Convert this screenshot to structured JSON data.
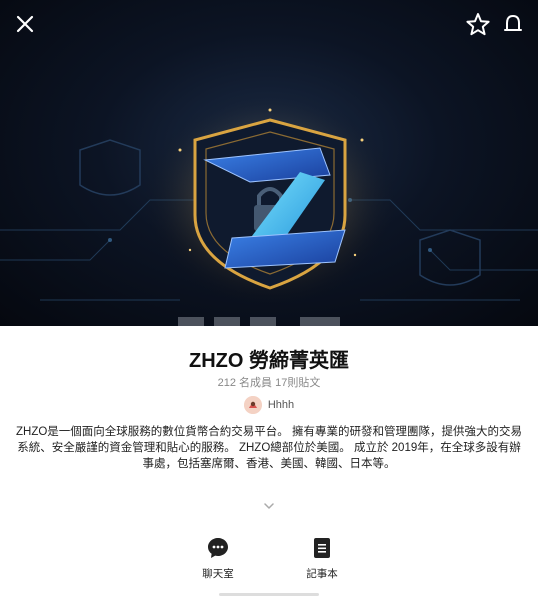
{
  "hero": {
    "close_icon": "close-icon",
    "star_icon": "star-icon",
    "bell_icon": "bell-icon",
    "logo_letter": "Z"
  },
  "group": {
    "name": "ZHZO 勞締菁英匯",
    "stats": "212 名成員 17則貼文",
    "owner_name": "Hhhh",
    "description": "ZHZO是一個面向全球服務的數位貨幣合約交易平台。 擁有專業的研發和管理團隊，提供強大的交易系統、安全嚴謹的資金管理和貼心的服務。 ZHZO總部位於美國。 成立於 2019年，在全球多設有辦事處，包括塞席爾、香港、美國、韓國、日本等。"
  },
  "actions": {
    "chat_label": "聊天室",
    "notes_label": "記事本"
  },
  "colors": {
    "accent_gold": "#d9a441",
    "logo_blue": "#2a6fd6"
  }
}
